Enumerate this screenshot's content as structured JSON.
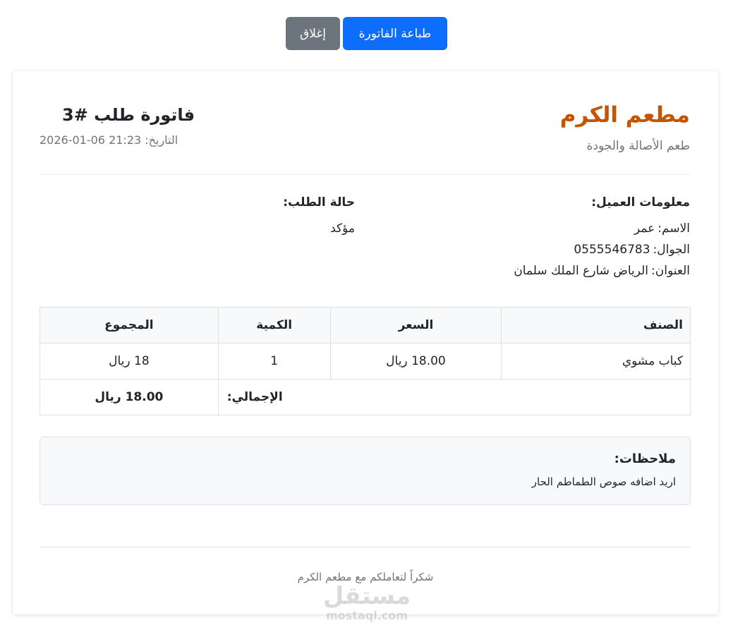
{
  "toolbar": {
    "print_label": "طباعة الفاتورة",
    "close_label": "إغلاق"
  },
  "restaurant": {
    "name": "مطعم الكرم",
    "tagline": "طعم الأصالة والجودة"
  },
  "invoice": {
    "title": "فاتورة طلب #3",
    "date_label": "التاريخ:",
    "date_value": "2026-01-06 21:23"
  },
  "customer": {
    "heading": "معلومات العميل:",
    "name_label": "الاسم:",
    "name_value": "عمر",
    "phone_label": "الجوال:",
    "phone_value": "0555546783",
    "address_label": "العنوان:",
    "address_value": "الرياض شارع الملك سلمان"
  },
  "order_status": {
    "heading": "حالة الطلب:",
    "value": "مؤكد"
  },
  "table": {
    "headers": {
      "item": "الصنف",
      "price": "السعر",
      "quantity": "الكمية",
      "total": "المجموع"
    },
    "rows": [
      {
        "item": "كباب مشوي",
        "price": "18.00 ريال",
        "quantity": "1",
        "total": "18 ريال"
      }
    ],
    "grand_total_label": "الإجمالي:",
    "grand_total_value": "18.00 ريال"
  },
  "notes": {
    "title": "ملاحظات:",
    "text": "اريد اضافه صوص الطماطم الحار"
  },
  "footer": {
    "thanks": "شكراً لتعاملكم مع مطعم الكرم"
  },
  "watermark": {
    "arabic": "مستقل",
    "latin": "mostaql.com"
  },
  "colors": {
    "brand": "#c45500",
    "primary_button": "#0d6efd",
    "secondary_button": "#6c757d"
  }
}
